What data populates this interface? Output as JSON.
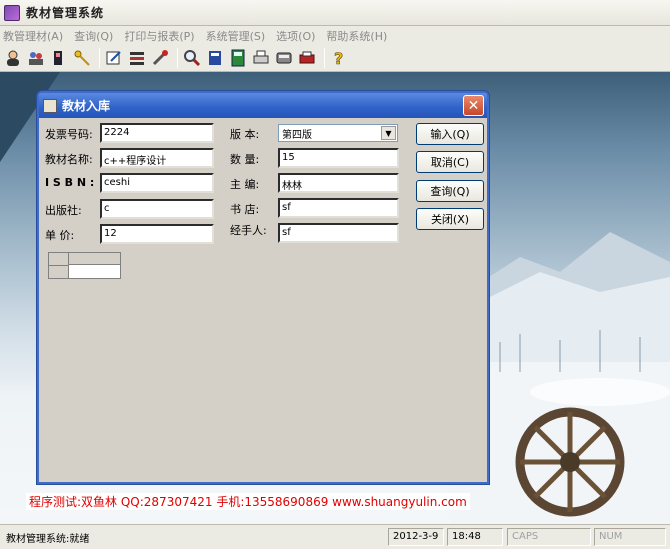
{
  "window": {
    "title": "教材管理系统"
  },
  "menu": [
    "教管理材(A)",
    "查询(Q)",
    "打印与报表(P)",
    "系统管理(S)",
    "选项(O)",
    "帮助系统(H)"
  ],
  "toolbar": {
    "group1": [
      "user-icon",
      "users-icon",
      "user-add-icon",
      "key-icon"
    ],
    "group2": [
      "edit-icon",
      "list-icon",
      "tools-icon"
    ],
    "group3": [
      "search-icon",
      "book-icon",
      "calculator-icon",
      "printer-icon",
      "disk-icon",
      "print-icon"
    ],
    "group4": [
      "help-icon"
    ]
  },
  "dialog": {
    "title": "教材入库",
    "close_glyph": "✕",
    "fields": {
      "invoice": {
        "label": "发票号码:",
        "value": "2224"
      },
      "name": {
        "label": "教材名称:",
        "value": "c++程序设计"
      },
      "isbn": {
        "label": "I S B N :",
        "value": "ceshi"
      },
      "publisher": {
        "label": "出版社:",
        "value": "c"
      },
      "price": {
        "label": "单  价:",
        "value": "12"
      },
      "edition": {
        "label": "版  本:",
        "value": "第四版"
      },
      "quantity": {
        "label": "数  量:",
        "value": "15"
      },
      "editor": {
        "label": "主  编:",
        "value": "林林"
      },
      "bookstore": {
        "label": "书  店:",
        "value": "sf"
      },
      "handler": {
        "label": "经手人:",
        "value": "sf"
      }
    },
    "buttons": {
      "input": "输入(Q)",
      "cancel": "取消(C)",
      "query": "查询(Q)",
      "close": "关闭(X)"
    }
  },
  "footer": {
    "text": "程序测试:双鱼林 QQ:287307421 手机:13558690869 www.shuangyulin.com"
  },
  "status": {
    "main": "教材管理系统:就绪",
    "date": "2012-3-9",
    "time": "18:48",
    "caps": "CAPS",
    "num": "NUM"
  },
  "colors": {
    "accent": "#2f61c8",
    "footer_text": "#e00000"
  }
}
